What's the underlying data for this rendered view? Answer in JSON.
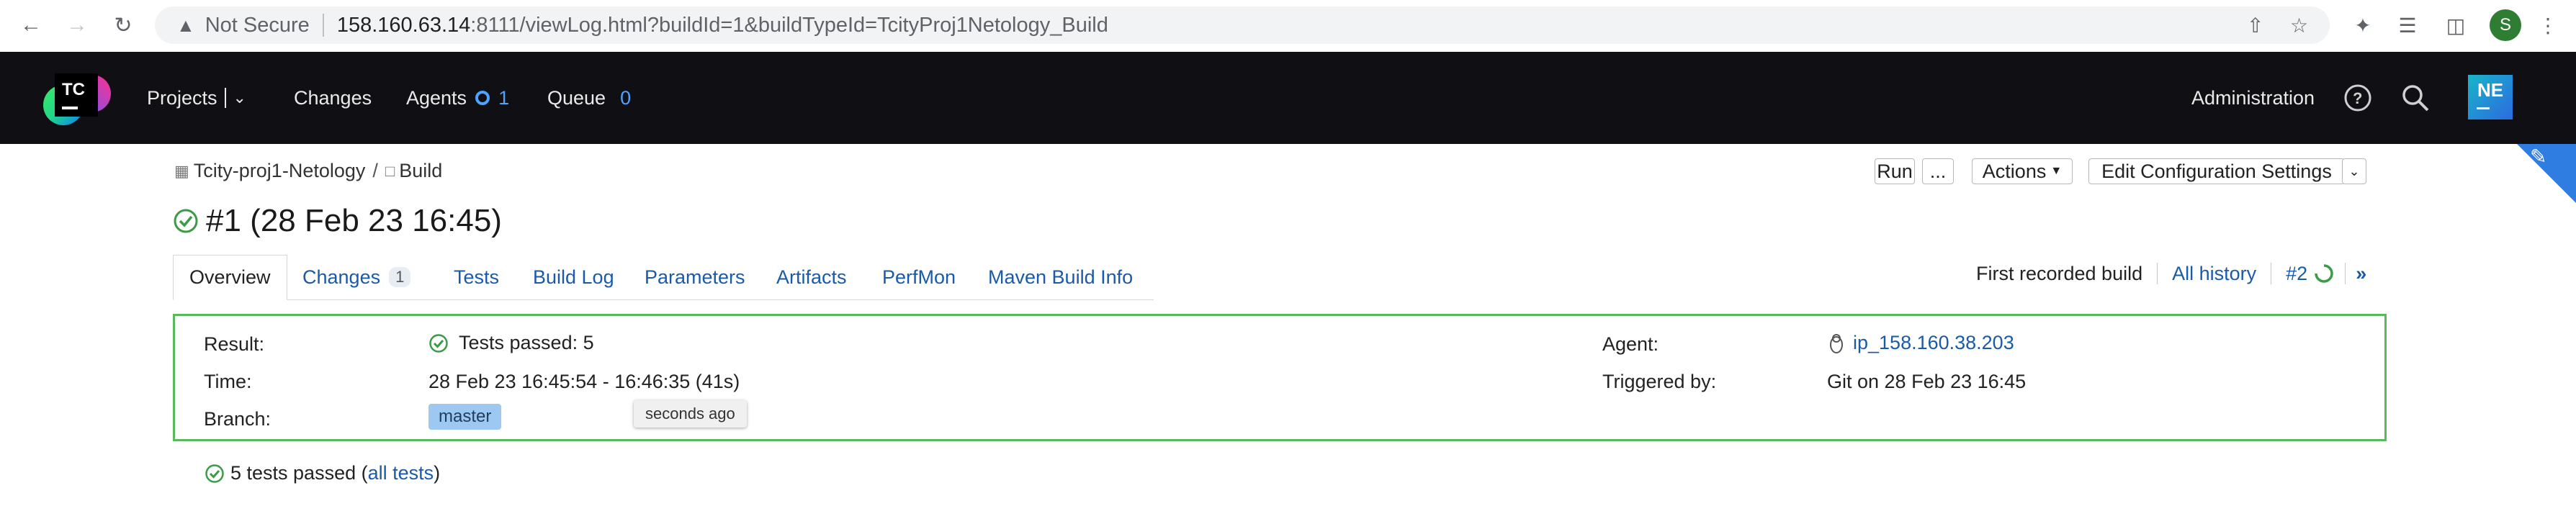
{
  "browser": {
    "security_label": "Not Secure",
    "url_host": "158.160.63.14",
    "url_path": ":8111/viewLog.html?buildId=1&buildTypeId=TcityProj1Netology_Build",
    "profile_initial": "S"
  },
  "header": {
    "logo_text": "TC",
    "nav": {
      "projects": "Projects",
      "changes": "Changes",
      "agents": "Agents",
      "agents_count": "1",
      "queue": "Queue",
      "queue_count": "0"
    },
    "administration": "Administration",
    "user_avatar": "NE"
  },
  "breadcrumb": {
    "project": "Tcity-proj1-Netology",
    "separator": "/",
    "build_config": "Build"
  },
  "actions": {
    "run": "Run",
    "run_more": "...",
    "actions": "Actions",
    "edit_config": "Edit Configuration Settings"
  },
  "build": {
    "title": "#1 (28 Feb 23 16:45)"
  },
  "tabs": [
    {
      "label": "Overview"
    },
    {
      "label": "Changes",
      "count": "1"
    },
    {
      "label": "Tests"
    },
    {
      "label": "Build Log"
    },
    {
      "label": "Parameters"
    },
    {
      "label": "Artifacts"
    },
    {
      "label": "PerfMon"
    },
    {
      "label": "Maven Build Info"
    }
  ],
  "history_nav": {
    "first_recorded": "First recorded build",
    "all_history": "All history",
    "next_build": "#2",
    "last": "»"
  },
  "summary": {
    "result_label": "Result:",
    "result_value": "Tests passed: 5",
    "time_label": "Time:",
    "time_value": "28 Feb 23 16:45:54 - 16:46:35 (41s)",
    "branch_label": "Branch:",
    "branch_value": "master",
    "agent_label": "Agent:",
    "agent_value": "ip_158.160.38.203",
    "triggered_label": "Triggered by:",
    "triggered_value": "Git on 28 Feb 23 16:45"
  },
  "tooltip": "seconds ago",
  "tests_summary": {
    "text": "5 tests passed (",
    "link": "all tests",
    "close": ")"
  },
  "colors": {
    "header_bg": "#0f0f14",
    "link": "#1a5aa8",
    "success_border": "#5cb85c",
    "branch_tag": "#9cc8f2",
    "accent_blue": "#2f7de1"
  }
}
